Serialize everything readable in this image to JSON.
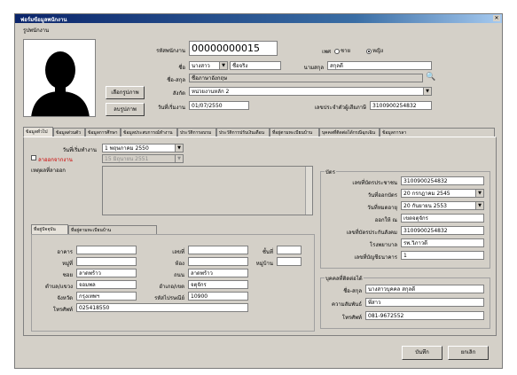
{
  "window": {
    "title": "ฟอร์มข้อมูลพนักงาน",
    "close": "✕"
  },
  "photo": {
    "caption": "รูปพนักงาน"
  },
  "buttons": {
    "select_photo": "เลือกรูปภาพ",
    "delete_photo": "ลบรูปภาพ",
    "save": "บันทึก",
    "cancel": "ยกเลิก"
  },
  "header": {
    "emp_code_label": "รหัสพนักงาน",
    "emp_code_value": "00000000015",
    "sex_label": "เพศ",
    "sex_options": [
      "ชาย",
      "หญิง"
    ],
    "sex_selected": "หญิง",
    "name_label": "ชื่อ",
    "prefix_value": "นางสาว",
    "firstname_value": "ชื่อจริง",
    "lastname_label": "นามสกุล",
    "lastname_value": "สกุลดี",
    "english_label": "ชื่อ-สกุล",
    "english_value": "ชื่อภาษาอังกฤษ",
    "dept_label": "สังกัด",
    "dept_value": "หน่วยงานหลัก 2",
    "start_label": "วันที่เริ่มงาน",
    "start_value": "01/07/2550",
    "tax_label": "เลขประจำตัวผู้เสียภาษี",
    "tax_value": "3100900254832"
  },
  "tabs": [
    "ข้อมูลทั่วไป",
    "ข้อมูลส่วนตัว",
    "ข้อมูลการศึกษา",
    "ข้อมูลประสบการณ์ทำงาน",
    "ประวัติการอบรม",
    "ประวัติการปรับเงินเดือน",
    "ที่อยู่ตามทะเบียนบ้าน",
    "บุคคลที่ติดต่อได้กรณีฉุกเฉิน",
    "ข้อมูลการลา"
  ],
  "general": {
    "start_date_label": "วันที่เริ่มทำงาน",
    "start_day": "1",
    "start_month": "พฤษภาคม",
    "start_year": "2550",
    "resign_label": "ลาออกจากงาน",
    "resign_day": "15",
    "resign_month": "มิถุนายน",
    "resign_year": "2551",
    "reason_label": "เหตุผลที่ลาออก"
  },
  "subtabs": [
    "ที่อยู่ปัจจุบัน",
    "ที่อยู่ตามทะเบียนบ้าน"
  ],
  "address": {
    "no_label": "เลขที่",
    "no_value": "",
    "moo_label": "หมู่ที่",
    "moo_value": "",
    "soi_label": "ซอย",
    "soi_value": "ลาดพร้าว",
    "road_label": "ถนน",
    "road_value": "ลาดพร้าว",
    "building_label": "อาคาร",
    "building_value": "",
    "room_label": "ห้อง",
    "room_value": "",
    "village_label": "หมู่บ้าน",
    "village_value": "",
    "floor_label": "ชั้นที่",
    "floor_value": "",
    "tambon_label": "ตำบล/แขวง",
    "tambon_value": "จอมพล",
    "amphoe_label": "อำเภอ/เขต",
    "amphoe_value": "จตุจักร",
    "province_label": "จังหวัด",
    "province_value": "กรุงเทพฯ",
    "postal_label": "รหัสไปรษณีย์",
    "postal_value": "10900",
    "phone_label": "โทรศัพท์",
    "phone_value": "025418550"
  },
  "card": {
    "group_title": "บัตร",
    "id_label": "เลขที่บัตรประชาชน",
    "id_value": "3100900254832",
    "issue_label": "วันที่ออกบัตร",
    "issue_day": "20",
    "issue_month": "กรกฎาคม",
    "issue_year": "2545",
    "expire_label": "วันที่หมดอายุ",
    "expire_day": "20",
    "expire_month": "กันยายน",
    "expire_year": "2553",
    "issued_at_label": "ออกให้ ณ",
    "issued_at_value": "เขตจตุจักร",
    "social_label": "เลขที่บัตรประกันสังคม",
    "social_value": "3100900254832",
    "hospital_label": "โรงพยาบาล",
    "hospital_value": "รพ.วิภาวดี",
    "bank_label": "เลขที่บัญชีธนาคาร",
    "bank_value": "1"
  },
  "contact": {
    "group_title": "บุคคลที่ติดต่อได้",
    "name_label": "ชื่อ-สกุล",
    "name_value": "นางสาวบุคคล สกุลดี",
    "relation_label": "ความสัมพันธ์",
    "relation_value": "พี่สาว",
    "phone_label": "โทรศัพท์",
    "phone_value": "081-9672552"
  }
}
